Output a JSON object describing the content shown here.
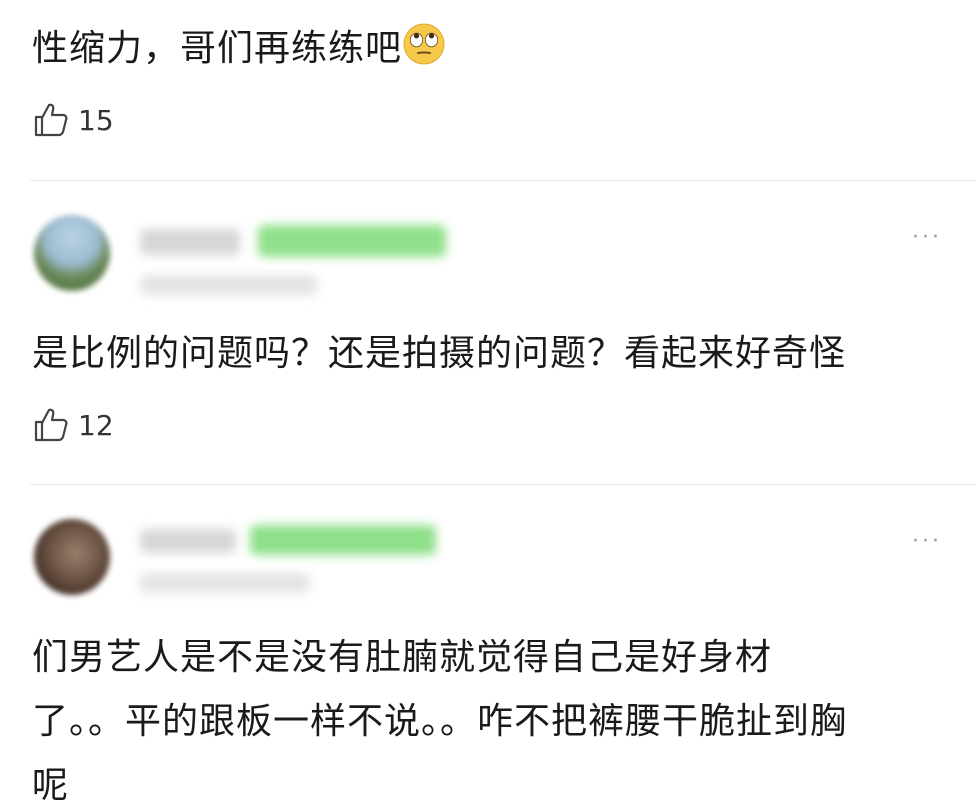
{
  "comments": [
    {
      "text": "性缩力，哥们再练练吧",
      "emoji": "rolling-eyes-emoji",
      "likes": "15"
    },
    {
      "text": "是比例的问题吗？还是拍摄的问题？看起来好奇怪",
      "likes": "12",
      "more_label": "···"
    },
    {
      "lines": [
        "们男艺人是不是没有肚腩就觉得自己是好身材",
        "了。。平的跟板一样不说。。咋不把裤腰干脆扯到胸",
        "呢"
      ],
      "more_label": "···"
    }
  ],
  "colors": {
    "badge_green": "#8fe08a",
    "text": "#1a1a1a",
    "muted": "#9a9a9a"
  }
}
